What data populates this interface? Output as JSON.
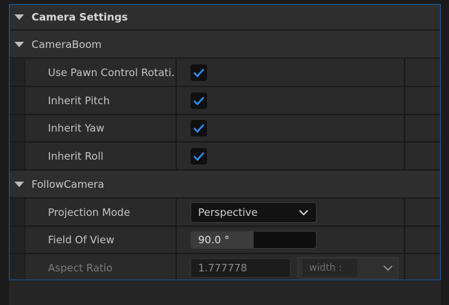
{
  "camera_settings": {
    "title": "Camera Settings",
    "sections": [
      {
        "title": "CameraBoom",
        "properties": [
          {
            "label": "Use Pawn Control Rotati…",
            "checked": true
          },
          {
            "label": "Inherit Pitch",
            "checked": true
          },
          {
            "label": "Inherit Yaw",
            "checked": true
          },
          {
            "label": "Inherit Roll",
            "checked": true
          }
        ]
      },
      {
        "title": "FollowCamera",
        "projection_mode": {
          "label": "Projection Mode",
          "value": "Perspective"
        },
        "field_of_view": {
          "label": "Field Of View",
          "value": "90.0 °",
          "fill_fraction": 0.5
        },
        "aspect_ratio": {
          "label": "Aspect Ratio",
          "value": "1.777778",
          "combo_placeholder": "width :"
        }
      }
    ]
  },
  "colors": {
    "accent_blue": "#1f5fa6",
    "checkmark": "#2f8cf0"
  },
  "icons": {
    "expand": "triangle-down-icon",
    "checkbox": "checkmark-icon",
    "dropdown": "chevron-down-icon"
  }
}
